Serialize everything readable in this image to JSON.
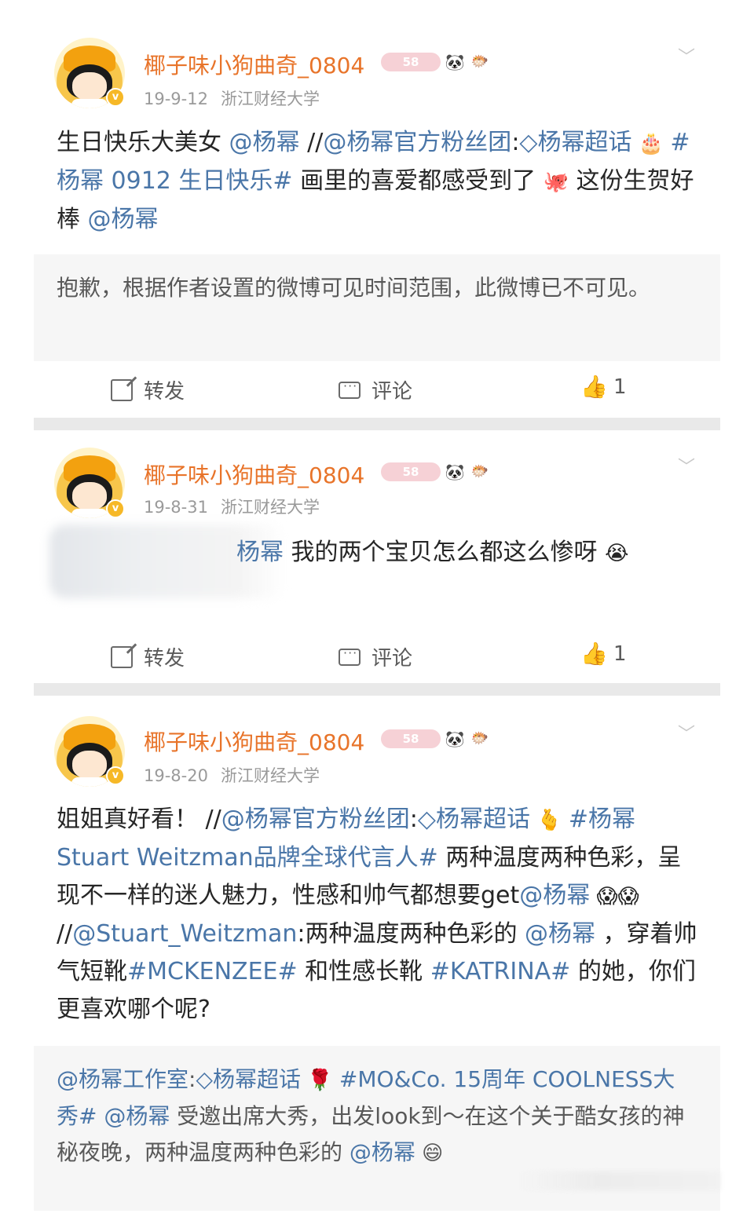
{
  "author": {
    "name": "椰子味小狗曲奇_0804",
    "level_badge": "58",
    "location": "浙江财经大学",
    "verified_mark": "v"
  },
  "icons": {
    "panda": "panda-icon",
    "fish": "pufferfish-icon",
    "chevron": "chevron-down-icon",
    "share": "share-icon",
    "comment": "comment-icon",
    "like": "thumbs-up-icon"
  },
  "colors": {
    "username": "#e8742a",
    "link": "#4a76a8",
    "meta": "#9a9a9a",
    "repost_bg": "#f6f6f6"
  },
  "actions": {
    "repost_label": "转发",
    "comment_label": "评论"
  },
  "posts": [
    {
      "date": "19-9-12",
      "like_count": "1",
      "body": [
        {
          "t": "生日快乐大美女 "
        },
        {
          "t": "@杨幂",
          "link": true
        },
        {
          "t": " //"
        },
        {
          "t": "@杨幂官方粉丝团",
          "link": true
        },
        {
          "t": ":"
        },
        {
          "t": "◇杨幂超话",
          "link": true
        },
        {
          "t": " 🎂 ",
          "emoji": true
        },
        {
          "t": "#杨幂 0912 生日快乐#",
          "link": true
        },
        {
          "t": " 画里的喜爱都感受到了 "
        },
        {
          "t": "🐙",
          "emoji": true
        },
        {
          "t": " 这份生贺好棒 "
        },
        {
          "t": "@杨幂",
          "link": true
        }
      ],
      "repost_text": "抱歉，根据作者设置的微博可见时间范围，此微博已不可见。"
    },
    {
      "date": "19-8-31",
      "like_count": "1",
      "body": [
        {
          "t": "杨幂",
          "link": true
        },
        {
          "t": " 我的两个宝贝怎么都这么惨呀 "
        },
        {
          "t": "😭",
          "emoji": true
        }
      ]
    },
    {
      "date": "19-8-20",
      "body": [
        {
          "t": "姐姐真好看！ //"
        },
        {
          "t": "@杨幂官方粉丝团",
          "link": true
        },
        {
          "t": ":"
        },
        {
          "t": "◇杨幂超话",
          "link": true
        },
        {
          "t": " 🫰 ",
          "emoji": true
        },
        {
          "t": "#杨幂 Stuart Weitzman品牌全球代言人#",
          "link": true
        },
        {
          "t": " 两种温度两种色彩，呈现不一样的迷人魅力，性感和帅气都想要get"
        },
        {
          "t": "@杨幂",
          "link": true
        },
        {
          "t": " 😱😱",
          "emoji": true
        },
        {
          "t": " //"
        },
        {
          "t": "@Stuart_Weitzman",
          "link": true
        },
        {
          "t": ":两种温度两种色彩的 "
        },
        {
          "t": "@杨幂",
          "link": true
        },
        {
          "t": " ，穿着帅气短靴"
        },
        {
          "t": "#MCKENZEE#",
          "link": true
        },
        {
          "t": " 和性感长靴 "
        },
        {
          "t": "#KATRINA#",
          "link": true
        },
        {
          "t": " 的她，你们更喜欢哪个呢?"
        }
      ],
      "repost_body": [
        {
          "t": "@杨幂工作室",
          "link": true
        },
        {
          "t": ":"
        },
        {
          "t": "◇杨幂超话",
          "link": true
        },
        {
          "t": " 🌹 ",
          "emoji": true
        },
        {
          "t": "#MO&Co. 15周年 COOLNESS大秀#",
          "link": true
        },
        {
          "t": " "
        },
        {
          "t": "@杨幂",
          "link": true
        },
        {
          "t": " 受邀出席大秀，出发look到～在这个关于酷女孩的神秘夜晚，两种温度两种色彩的 "
        },
        {
          "t": "@杨幂",
          "link": true
        },
        {
          "t": " 😄",
          "emoji": true
        }
      ]
    }
  ]
}
